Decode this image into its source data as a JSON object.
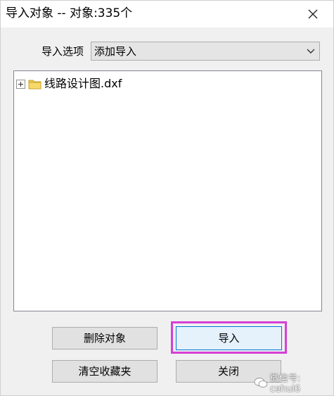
{
  "window": {
    "title": "导入对象 -- 对象:335个"
  },
  "options": {
    "label": "导入选项",
    "selected": "添加导入"
  },
  "tree": {
    "items": [
      {
        "label": "线路设计图.dxf",
        "icon": "folder-icon",
        "expanded": false
      }
    ]
  },
  "buttons": {
    "delete": "删除对象",
    "import": "导入",
    "clear_favorites": "清空收藏夹",
    "close": "关闭"
  },
  "watermark": {
    "text": "微信号: cehui6"
  },
  "colors": {
    "highlight": "#d63fd6",
    "focus_border": "#0078d7",
    "folder": "#f2c94c"
  }
}
